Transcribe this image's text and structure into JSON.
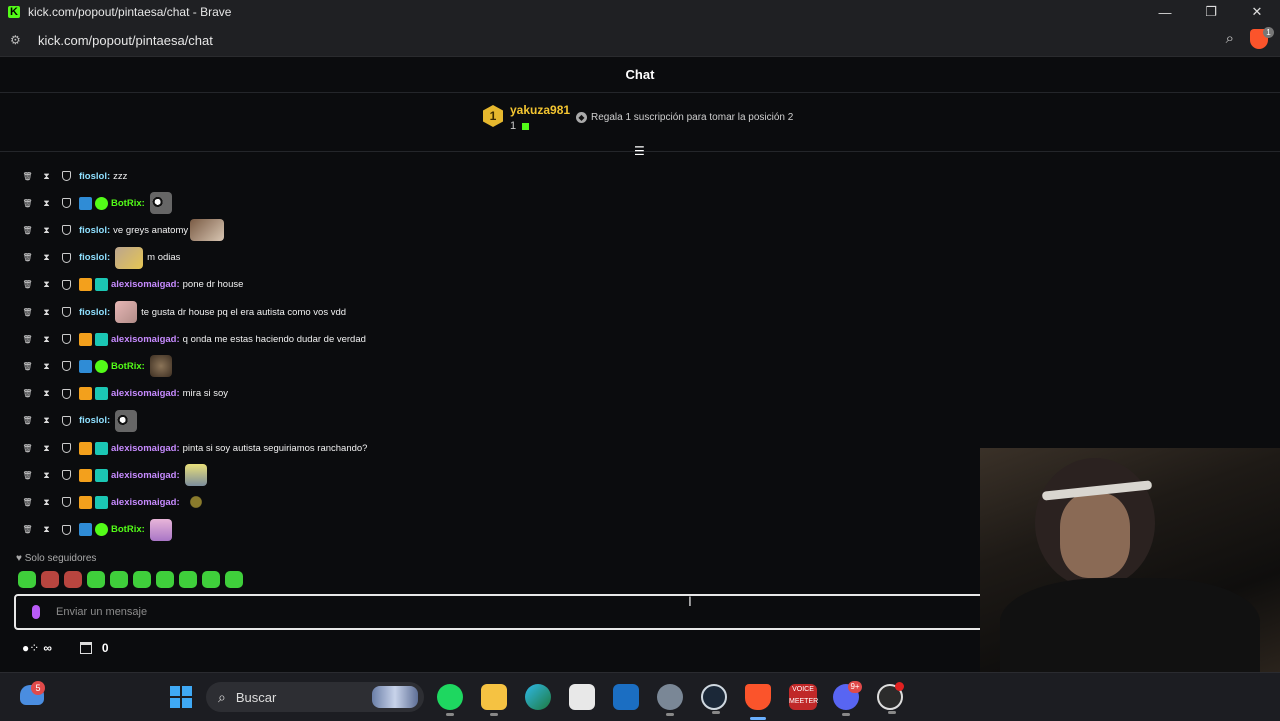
{
  "window": {
    "title": "kick.com/popout/pintaesa/chat - Brave",
    "url": "kick.com/popout/pintaesa/chat"
  },
  "chat": {
    "header": "Chat",
    "leaderboard": {
      "rank": "1",
      "username": "yakuza981",
      "count": "1",
      "gift_text": "Regala 1 suscripción para tomar la posición 2"
    },
    "messages": [
      {
        "user": "fioslol:",
        "color": "#8fe0ff",
        "badges": [],
        "text": "zzz",
        "emote": ""
      },
      {
        "user": "BotRix:",
        "color": "#53fc18",
        "badges": [
          "bot",
          "verified"
        ],
        "text": "",
        "emote": "em1"
      },
      {
        "user": "fioslol:",
        "color": "#8fe0ff",
        "badges": [],
        "text": "ve greys anatomy",
        "emote": "em2"
      },
      {
        "user": "fioslol:",
        "color": "#8fe0ff",
        "badges": [],
        "text": "m odias",
        "emote": "em3",
        "emote_first": true
      },
      {
        "user": "alexisomaigad:",
        "color": "#c78bff",
        "badges": [
          "crown",
          "sub"
        ],
        "text": "pone dr house",
        "emote": ""
      },
      {
        "user": "fioslol:",
        "color": "#8fe0ff",
        "badges": [],
        "text": "te gusta dr house pq el era autista como vos vdd",
        "emote": "em4",
        "emote_first": true
      },
      {
        "user": "alexisomaigad:",
        "color": "#c78bff",
        "badges": [
          "crown",
          "sub"
        ],
        "text": "q onda me estas haciendo dudar de verdad",
        "emote": ""
      },
      {
        "user": "BotRix:",
        "color": "#53fc18",
        "badges": [
          "bot",
          "verified"
        ],
        "text": "",
        "emote": "em5"
      },
      {
        "user": "alexisomaigad:",
        "color": "#c78bff",
        "badges": [
          "crown",
          "sub"
        ],
        "text": "mira si soy",
        "emote": ""
      },
      {
        "user": "fioslol:",
        "color": "#8fe0ff",
        "badges": [],
        "text": "",
        "emote": "em1"
      },
      {
        "user": "alexisomaigad:",
        "color": "#c78bff",
        "badges": [
          "crown",
          "sub"
        ],
        "text": "pinta si soy autista seguiriamos ranchando?",
        "emote": ""
      },
      {
        "user": "alexisomaigad:",
        "color": "#c78bff",
        "badges": [
          "crown",
          "sub"
        ],
        "text": "",
        "emote": "em6"
      },
      {
        "user": "alexisomaigad:",
        "color": "#c78bff",
        "badges": [
          "crown",
          "sub"
        ],
        "text": "",
        "emote": "em7"
      },
      {
        "user": "BotRix:",
        "color": "#53fc18",
        "badges": [
          "bot",
          "verified"
        ],
        "text": "",
        "emote": "em8"
      }
    ],
    "followers_only": "Solo seguidores",
    "input_placeholder": "Enviar un mensaje",
    "footer": {
      "points_label": "∞",
      "store_count": "0"
    }
  },
  "taskbar": {
    "weather_badge": "5",
    "search_label": "Buscar",
    "voice_label": "VOICE MEETER",
    "discord_badge": "9+"
  }
}
